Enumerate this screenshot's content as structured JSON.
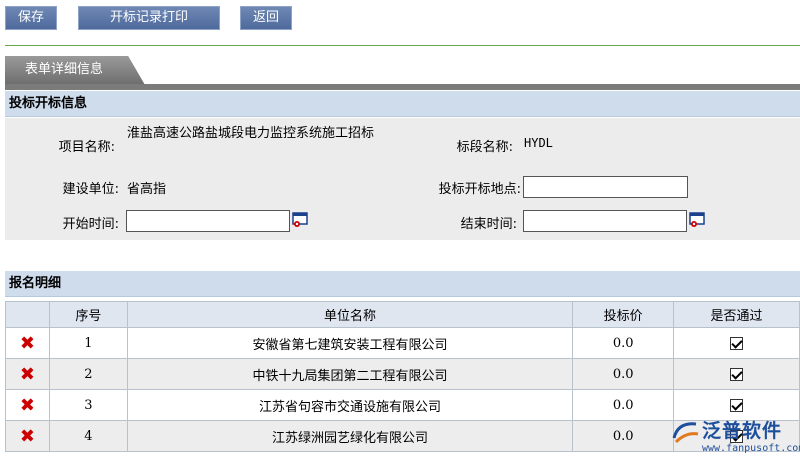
{
  "toolbar": {
    "save_label": "保存",
    "print_label": "开标记录打印",
    "back_label": "返回"
  },
  "tab": {
    "label": "表单详细信息"
  },
  "bid_section": {
    "title": "投标开标信息",
    "project_name_label": "项目名称:",
    "project_name_value": "淮盐高速公路盐城段电力监控系统施工招标",
    "lot_name_label": "标段名称:",
    "lot_name_value": "HYDL",
    "builder_label": "建设单位:",
    "builder_value": "省高指",
    "location_label": "投标开标地点:",
    "location_value": "",
    "start_time_label": "开始时间:",
    "start_time_value": "",
    "end_time_label": "结束时间:",
    "end_time_value": ""
  },
  "registration": {
    "title": "报名明细",
    "columns": [
      "序号",
      "单位名称",
      "投标价",
      "是否通过"
    ],
    "rows": [
      {
        "seq": "1",
        "company": "安徽省第七建筑安装工程有限公司",
        "price": "0.0",
        "passed": true
      },
      {
        "seq": "2",
        "company": "中铁十九局集团第二工程有限公司",
        "price": "0.0",
        "passed": true
      },
      {
        "seq": "3",
        "company": "江苏省句容市交通设施有限公司",
        "price": "0.0",
        "passed": true
      },
      {
        "seq": "4",
        "company": "江苏绿洲园艺绿化有限公司",
        "price": "0.0",
        "passed": true
      }
    ]
  },
  "watermark": {
    "brand": "泛普软件",
    "url": "www.fanpusoft.com"
  },
  "colors": {
    "button_bg": "#5a74a6",
    "section_header_bg": "#cfdcec",
    "delete_mark": "#cc0000",
    "brand_blue": "#1d4f9c"
  }
}
